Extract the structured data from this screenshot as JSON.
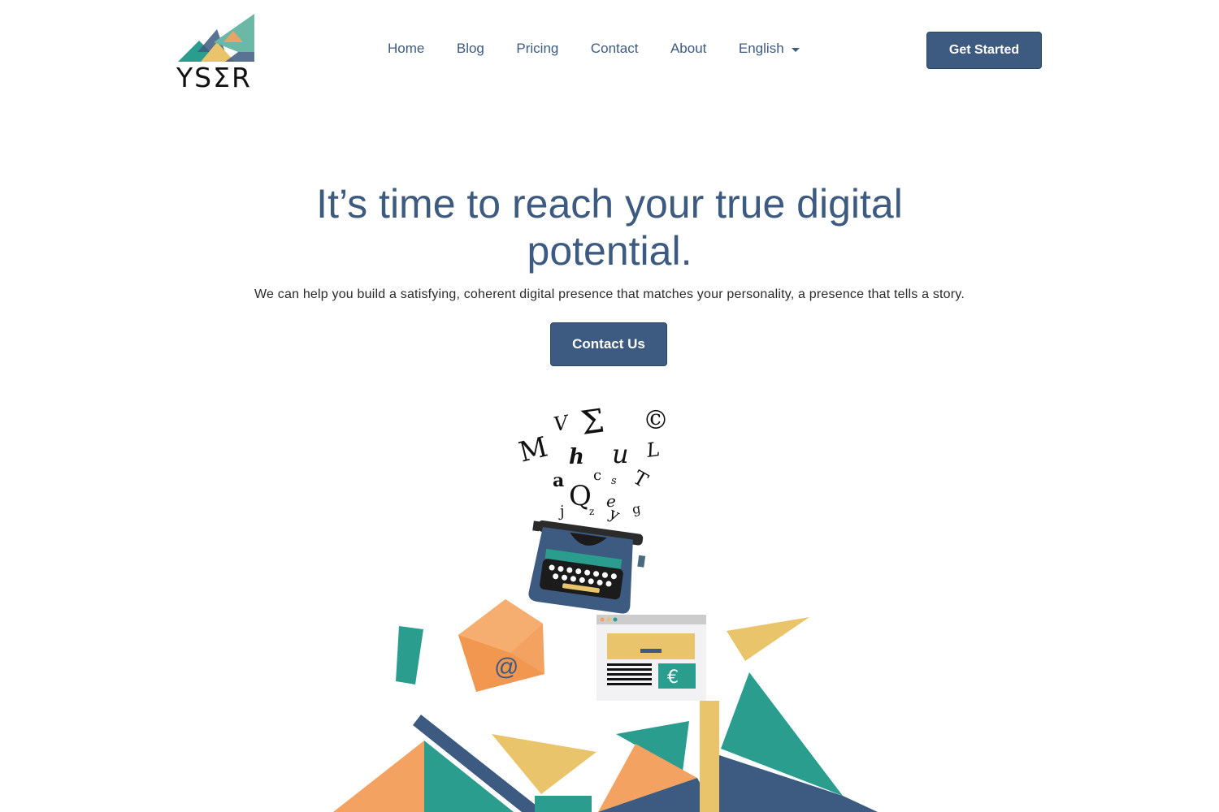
{
  "brand": {
    "logo_text": "YSƩR",
    "colors": {
      "primary": "#3d5a80",
      "teal": "#2a9d8f",
      "orange": "#f4a261",
      "yellow": "#e9c46a",
      "navy": "#3d5a80"
    }
  },
  "nav": {
    "items": [
      {
        "label": "Home"
      },
      {
        "label": "Blog"
      },
      {
        "label": "Pricing"
      },
      {
        "label": "Contact"
      },
      {
        "label": "About"
      }
    ],
    "language": "English",
    "cta_label": "Get Started"
  },
  "hero": {
    "title_line1": "It’s time to reach your true digital",
    "title_line2": "potential.",
    "subtitle": "We can help you build a satisfying, coherent digital presence that matches your personality, a presence that tells a story.",
    "cta_label": "Contact Us"
  },
  "illustration": {
    "email_symbol": "@",
    "currency_symbol": "€",
    "letters": [
      "V",
      "Σ",
      "©",
      "M",
      "h",
      "u",
      "L",
      "a",
      "c",
      "s",
      "T",
      "Q",
      "e",
      "j",
      "z",
      "y",
      "g"
    ]
  }
}
